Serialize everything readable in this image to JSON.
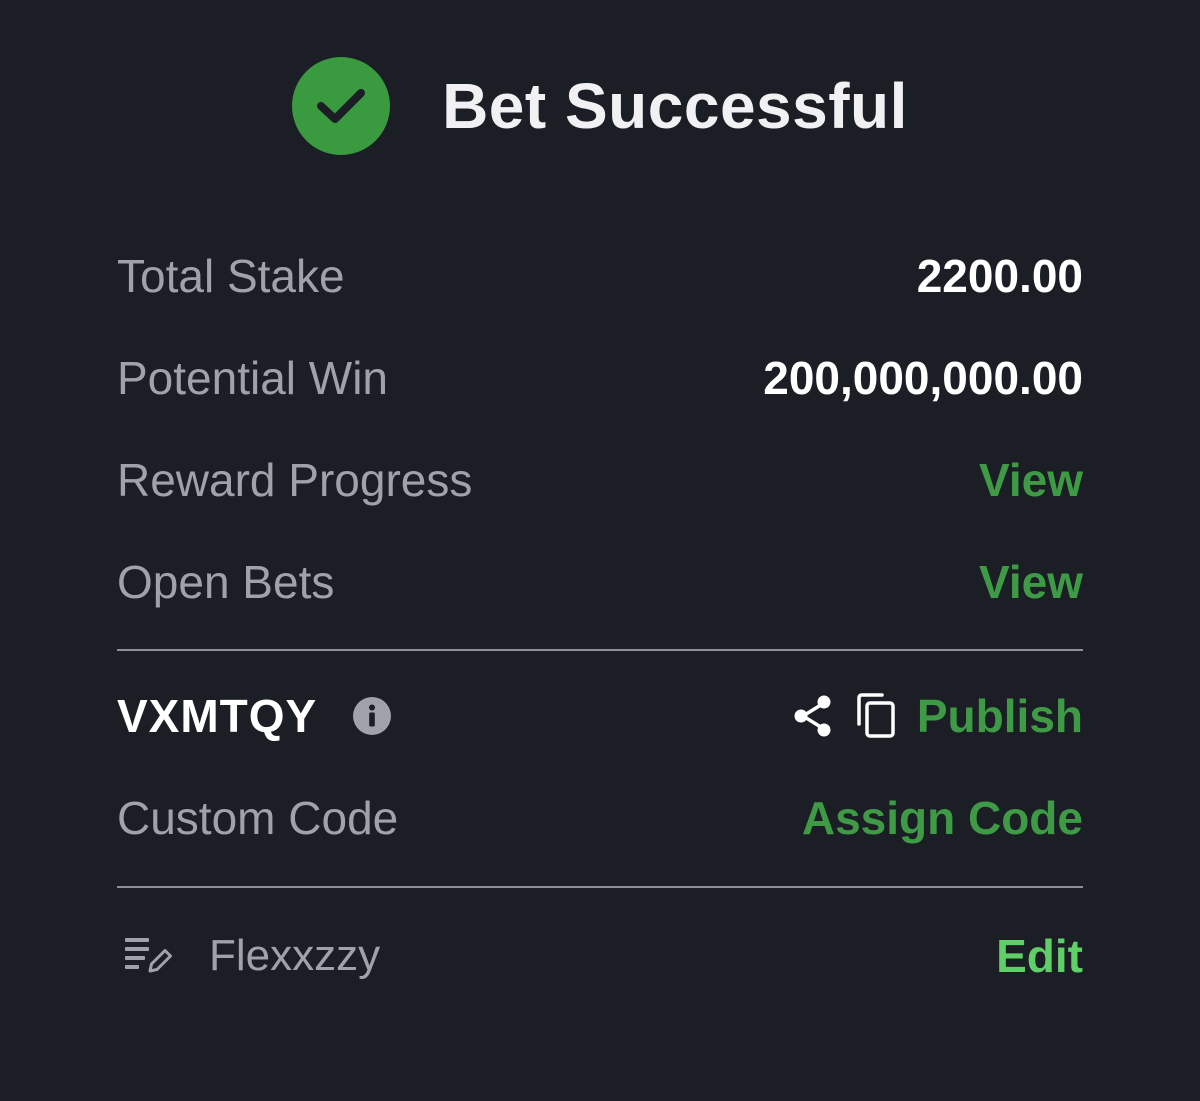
{
  "header": {
    "title": "Bet Successful"
  },
  "summary": {
    "total_stake_label": "Total Stake",
    "total_stake_value": "2200.00",
    "potential_win_label": "Potential Win",
    "potential_win_value": "200,000,000.00",
    "reward_progress_label": "Reward Progress",
    "reward_progress_link": "View",
    "open_bets_label": "Open Bets",
    "open_bets_link": "View"
  },
  "booking": {
    "code": "VXMTQY",
    "publish_label": "Publish",
    "custom_code_label": "Custom Code",
    "assign_code_label": "Assign Code"
  },
  "note": {
    "text": "Flexxzzy",
    "edit_label": "Edit"
  },
  "icons": {
    "success": "check-circle-icon",
    "info": "info-icon",
    "share": "share-icon",
    "copy": "copy-icon",
    "note": "edit-note-icon"
  },
  "colors": {
    "background": "#1b1e25",
    "success_green": "#3a9a3f",
    "link_green": "#3f9a46",
    "edit_green": "#5fd068",
    "label_gray": "#9fa2a9",
    "value_white": "#ffffff"
  }
}
